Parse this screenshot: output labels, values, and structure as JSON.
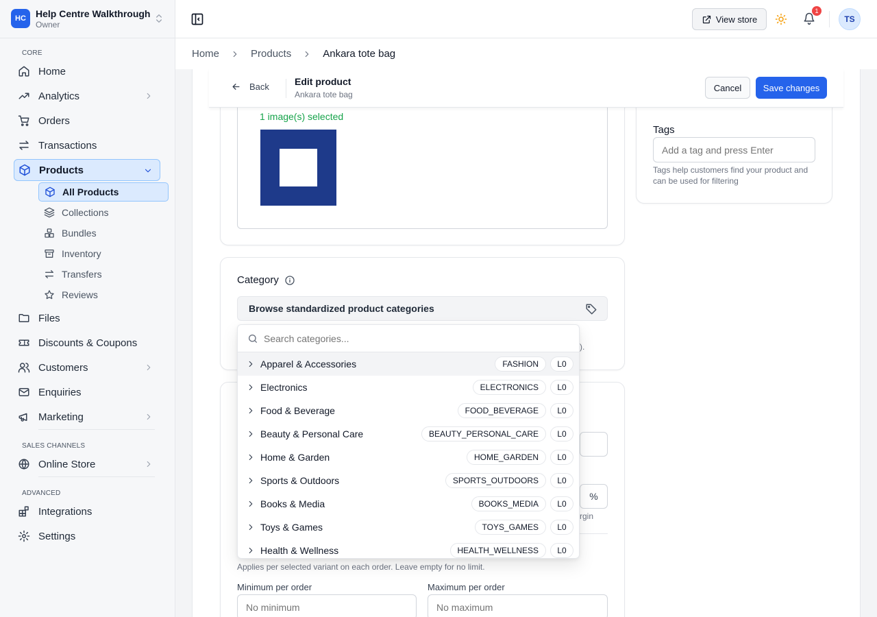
{
  "workspace": {
    "initials": "HC",
    "name": "Help Centre Walkthrough",
    "role": "Owner"
  },
  "sidebar": {
    "core_label": "CORE",
    "sales_label": "SALES CHANNELS",
    "advanced_label": "ADVANCED",
    "items": {
      "home": "Home",
      "analytics": "Analytics",
      "orders": "Orders",
      "transactions": "Transactions",
      "products": "Products",
      "files": "Files",
      "discounts": "Discounts & Coupons",
      "customers": "Customers",
      "enquiries": "Enquiries",
      "marketing": "Marketing",
      "online_store": "Online Store",
      "integrations": "Integrations",
      "settings": "Settings"
    },
    "product_sub": {
      "all": "All Products",
      "collections": "Collections",
      "bundles": "Bundles",
      "inventory": "Inventory",
      "transfers": "Transfers",
      "reviews": "Reviews"
    }
  },
  "topbar": {
    "view_store": "View store",
    "notifications": "1",
    "avatar": "TS"
  },
  "breadcrumb": {
    "home": "Home",
    "products": "Products",
    "current": "Ankara tote bag"
  },
  "editbar": {
    "back": "Back",
    "title": "Edit product",
    "subtitle": "Ankara tote bag",
    "cancel": "Cancel",
    "save": "Save changes"
  },
  "media": {
    "selected_text": "1 image(s) selected"
  },
  "category": {
    "label": "Category",
    "browse": "Browse standardized product categories",
    "search_placeholder": "Search categories...",
    "items": [
      {
        "name": "Apparel & Accessories",
        "code": "FASHION",
        "level": "L0"
      },
      {
        "name": "Electronics",
        "code": "ELECTRONICS",
        "level": "L0"
      },
      {
        "name": "Food & Beverage",
        "code": "FOOD_BEVERAGE",
        "level": "L0"
      },
      {
        "name": "Beauty & Personal Care",
        "code": "BEAUTY_PERSONAL_CARE",
        "level": "L0"
      },
      {
        "name": "Home & Garden",
        "code": "HOME_GARDEN",
        "level": "L0"
      },
      {
        "name": "Sports & Outdoors",
        "code": "SPORTS_OUTDOORS",
        "level": "L0"
      },
      {
        "name": "Books & Media",
        "code": "BOOKS_MEDIA",
        "level": "L0"
      },
      {
        "name": "Toys & Games",
        "code": "TOYS_GAMES",
        "level": "L0"
      },
      {
        "name": "Health & Wellness",
        "code": "HEALTH_WELLNESS",
        "level": "L0"
      }
    ]
  },
  "partials": {
    "paren": ").",
    "percent": "%",
    "margin": "rgin"
  },
  "tags": {
    "title": "Tags",
    "placeholder": "Add a tag and press Enter",
    "help": "Tags help customers find your product and can be used for filtering"
  },
  "limits": {
    "help": "Applies per selected variant on each order. Leave empty for no limit.",
    "min_label": "Minimum per order",
    "min_placeholder": "No minimum",
    "max_label": "Maximum per order",
    "max_placeholder": "No maximum"
  },
  "colors": {
    "accent": "#2563eb",
    "active_bg": "#dbeafe",
    "success": "#16a34a",
    "badge": "#ef4444",
    "thumb": "#1e3a8a"
  }
}
